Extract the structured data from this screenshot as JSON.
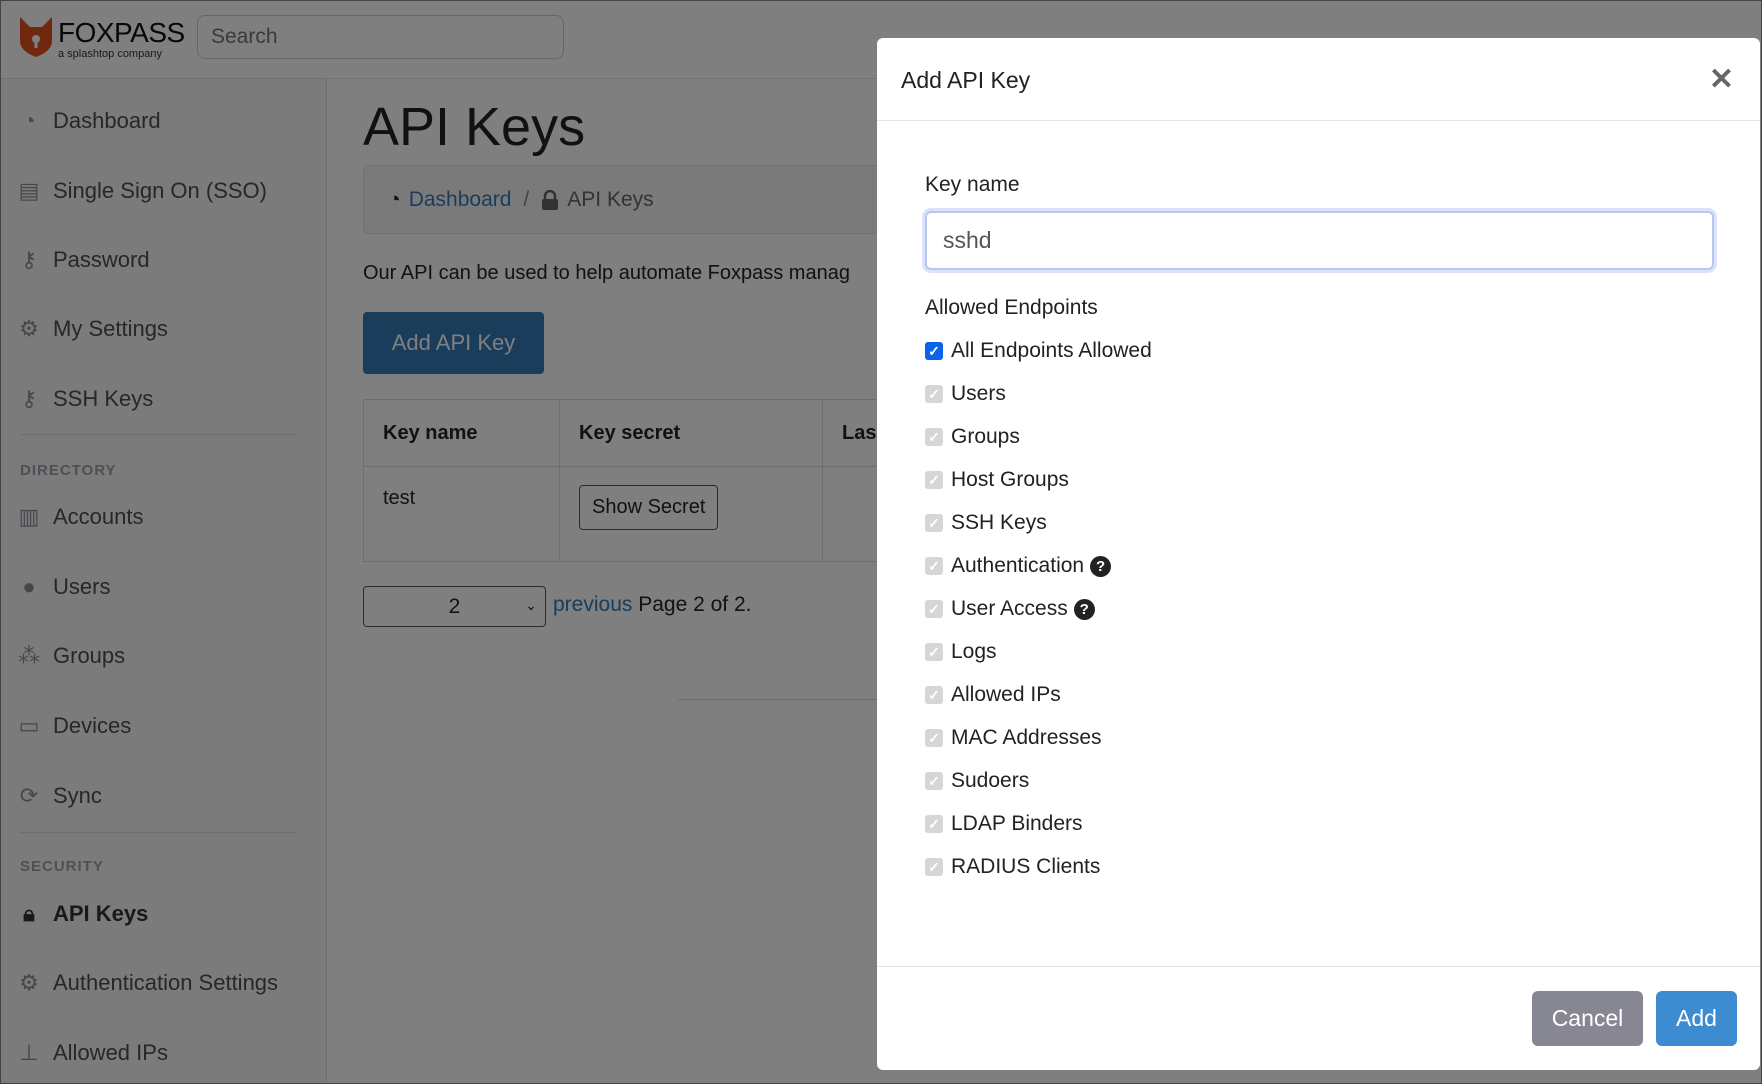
{
  "header": {
    "logo_text": "FOXPASS",
    "logo_sub": "a splashtop company",
    "search_placeholder": "Search"
  },
  "sidebar": {
    "items": [
      {
        "label": "Dashboard",
        "icon": "dashboard-icon"
      },
      {
        "label": "Single Sign On (SSO)",
        "icon": "id-card-icon"
      },
      {
        "label": "Password",
        "icon": "key-icon"
      },
      {
        "label": "My Settings",
        "icon": "gears-icon"
      },
      {
        "label": "SSH Keys",
        "icon": "key-icon"
      }
    ],
    "directory_heading": "DIRECTORY",
    "directory_items": [
      {
        "label": "Accounts",
        "icon": "building-icon"
      },
      {
        "label": "Users",
        "icon": "user-icon"
      },
      {
        "label": "Groups",
        "icon": "users-icon"
      },
      {
        "label": "Devices",
        "icon": "laptop-icon"
      },
      {
        "label": "Sync",
        "icon": "sync-icon"
      }
    ],
    "security_heading": "SECURITY",
    "security_items": [
      {
        "label": "API Keys",
        "icon": "lock-icon",
        "active": true
      },
      {
        "label": "Authentication Settings",
        "icon": "gear-icon"
      },
      {
        "label": "Allowed IPs",
        "icon": "sitemap-icon"
      }
    ]
  },
  "main": {
    "title": "API Keys",
    "breadcrumb": {
      "home": "Dashboard",
      "separator": "/",
      "current": "API Keys"
    },
    "description": "Our API can be used to help automate Foxpass manag",
    "add_button": "Add API Key",
    "table": {
      "headers": [
        "Key name",
        "Key secret",
        "Las"
      ],
      "rows": [
        {
          "name": "test",
          "secret_button": "Show Secret"
        }
      ]
    },
    "pagination": {
      "selected_page": "2",
      "previous": "previous",
      "status": "Page 2 of 2."
    }
  },
  "modal": {
    "title": "Add API Key",
    "key_name_label": "Key name",
    "key_name_value": "sshd",
    "endpoints_label": "Allowed Endpoints",
    "endpoints": [
      {
        "label": "All Endpoints Allowed",
        "checked": true,
        "enabled": true
      },
      {
        "label": "Users",
        "checked": true,
        "enabled": false
      },
      {
        "label": "Groups",
        "checked": true,
        "enabled": false
      },
      {
        "label": "Host Groups",
        "checked": true,
        "enabled": false
      },
      {
        "label": "SSH Keys",
        "checked": true,
        "enabled": false
      },
      {
        "label": "Authentication",
        "checked": true,
        "enabled": false,
        "help": true
      },
      {
        "label": "User Access",
        "checked": true,
        "enabled": false,
        "help": true
      },
      {
        "label": "Logs",
        "checked": true,
        "enabled": false
      },
      {
        "label": "Allowed IPs",
        "checked": true,
        "enabled": false
      },
      {
        "label": "MAC Addresses",
        "checked": true,
        "enabled": false
      },
      {
        "label": "Sudoers",
        "checked": true,
        "enabled": false
      },
      {
        "label": "LDAP Binders",
        "checked": true,
        "enabled": false
      },
      {
        "label": "RADIUS Clients",
        "checked": true,
        "enabled": false
      }
    ],
    "help_glyph": "?",
    "cancel_label": "Cancel",
    "add_label": "Add"
  },
  "colors": {
    "primary": "#337ab7",
    "checkbox_checked": "#0a63e8",
    "add_button": "#3d8bd0",
    "cancel_button": "#868793",
    "logo_orange": "#e0531f"
  }
}
